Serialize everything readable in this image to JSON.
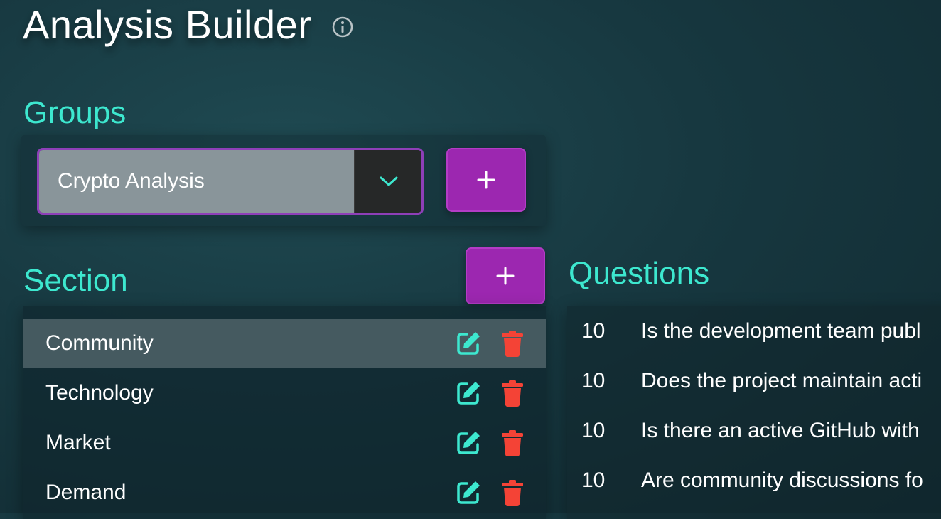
{
  "page": {
    "title": "Analysis Builder",
    "info_icon": "info-circle-icon"
  },
  "groups": {
    "heading": "Groups",
    "selected": "Crypto Analysis",
    "dropdown_icon": "chevron-down-icon",
    "add_icon": "plus-icon"
  },
  "sections": {
    "heading": "Section",
    "add_icon": "plus-icon",
    "items": [
      {
        "label": "Community",
        "selected": true,
        "edit_icon": "edit-icon",
        "delete_icon": "trash-icon"
      },
      {
        "label": "Technology",
        "selected": false,
        "edit_icon": "edit-icon",
        "delete_icon": "trash-icon"
      },
      {
        "label": "Market",
        "selected": false,
        "edit_icon": "edit-icon",
        "delete_icon": "trash-icon"
      },
      {
        "label": "Demand",
        "selected": false,
        "edit_icon": "edit-icon",
        "delete_icon": "trash-icon"
      }
    ]
  },
  "questions": {
    "heading": "Questions",
    "items": [
      {
        "score": "10",
        "text": "Is the development team publ"
      },
      {
        "score": "10",
        "text": "Does the project maintain acti"
      },
      {
        "score": "10",
        "text": "Is there an active GitHub with"
      },
      {
        "score": "10",
        "text": "Are community discussions fo"
      }
    ]
  },
  "colors": {
    "accent_heading": "#3de8cf",
    "button_purple": "#9c27b0",
    "edit_icon": "#3de8cf",
    "delete_icon": "#f44336",
    "selected_row": "#455a60"
  }
}
